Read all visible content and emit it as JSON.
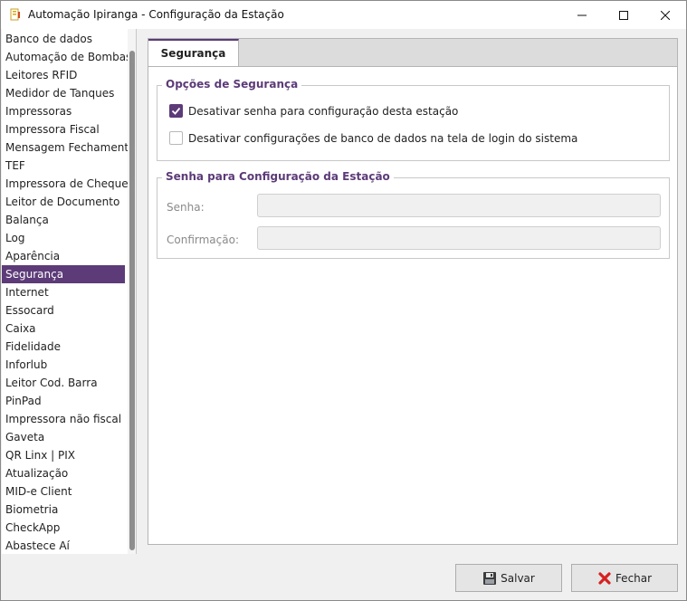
{
  "window": {
    "title": "Automação Ipiranga - Configuração da Estação",
    "accent": "#5c3b78"
  },
  "sidebar": {
    "items": [
      {
        "label": "Banco de dados"
      },
      {
        "label": "Automação de Bombas"
      },
      {
        "label": "Leitores RFID"
      },
      {
        "label": "Medidor de Tanques"
      },
      {
        "label": "Impressoras"
      },
      {
        "label": "Impressora Fiscal"
      },
      {
        "label": "Mensagem Fechamento"
      },
      {
        "label": "TEF"
      },
      {
        "label": "Impressora de Cheque"
      },
      {
        "label": "Leitor de Documento"
      },
      {
        "label": "Balança"
      },
      {
        "label": "Log"
      },
      {
        "label": "Aparência"
      },
      {
        "label": "Segurança",
        "selected": true
      },
      {
        "label": "Internet"
      },
      {
        "label": "Essocard"
      },
      {
        "label": "Caixa"
      },
      {
        "label": "Fidelidade"
      },
      {
        "label": "Inforlub"
      },
      {
        "label": "Leitor Cod. Barra"
      },
      {
        "label": "PinPad"
      },
      {
        "label": "Impressora não fiscal"
      },
      {
        "label": "Gaveta"
      },
      {
        "label": "QR Linx | PIX"
      },
      {
        "label": "Atualização"
      },
      {
        "label": "MID-e Client"
      },
      {
        "label": "Biometria"
      },
      {
        "label": "CheckApp"
      },
      {
        "label": "Abastece Aí"
      }
    ]
  },
  "tab": {
    "label": "Segurança"
  },
  "security_options": {
    "title": "Opções de Segurança",
    "options": [
      {
        "label": "Desativar senha para configuração desta estação",
        "checked": true
      },
      {
        "label": "Desativar configurações de banco de dados na tela de login do sistema",
        "checked": false
      }
    ]
  },
  "password_group": {
    "title": "Senha para Configuração da Estação",
    "password_label": "Senha:",
    "password_value": "",
    "confirm_label": "Confirmação:",
    "confirm_value": ""
  },
  "footer": {
    "save_label": "Salvar",
    "close_label": "Fechar"
  }
}
